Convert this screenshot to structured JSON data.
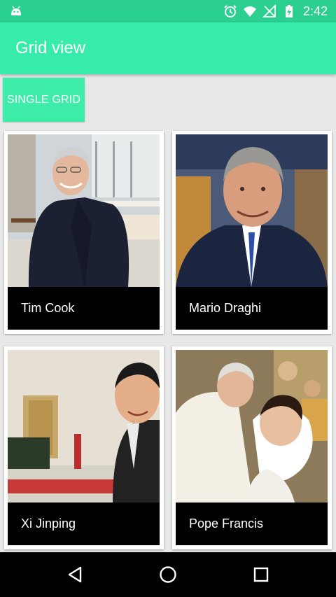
{
  "status_bar": {
    "time": "2:42",
    "icons": [
      "android-icon",
      "alarm-icon",
      "wifi-icon",
      "no-signal-icon",
      "battery-charging-icon"
    ]
  },
  "app_bar": {
    "title": "Grid view"
  },
  "toolbar": {
    "single_grid_label": "SINGLE GRID"
  },
  "grid": {
    "items": [
      {
        "name": "Tim Cook",
        "image": "tim-cook-photo"
      },
      {
        "name": "Mario Draghi",
        "image": "mario-draghi-photo"
      },
      {
        "name": "Xi Jinping",
        "image": "xi-jinping-photo"
      },
      {
        "name": "Pope Francis",
        "image": "pope-francis-photo"
      }
    ]
  },
  "nav_bar": {
    "buttons": [
      "back-icon",
      "home-icon",
      "recents-icon"
    ]
  },
  "colors": {
    "status_bar": "#2bcf8f",
    "app_bar": "#37ecab",
    "button": "#3ceca8",
    "background": "#e8e8e8",
    "caption": "#000000"
  }
}
